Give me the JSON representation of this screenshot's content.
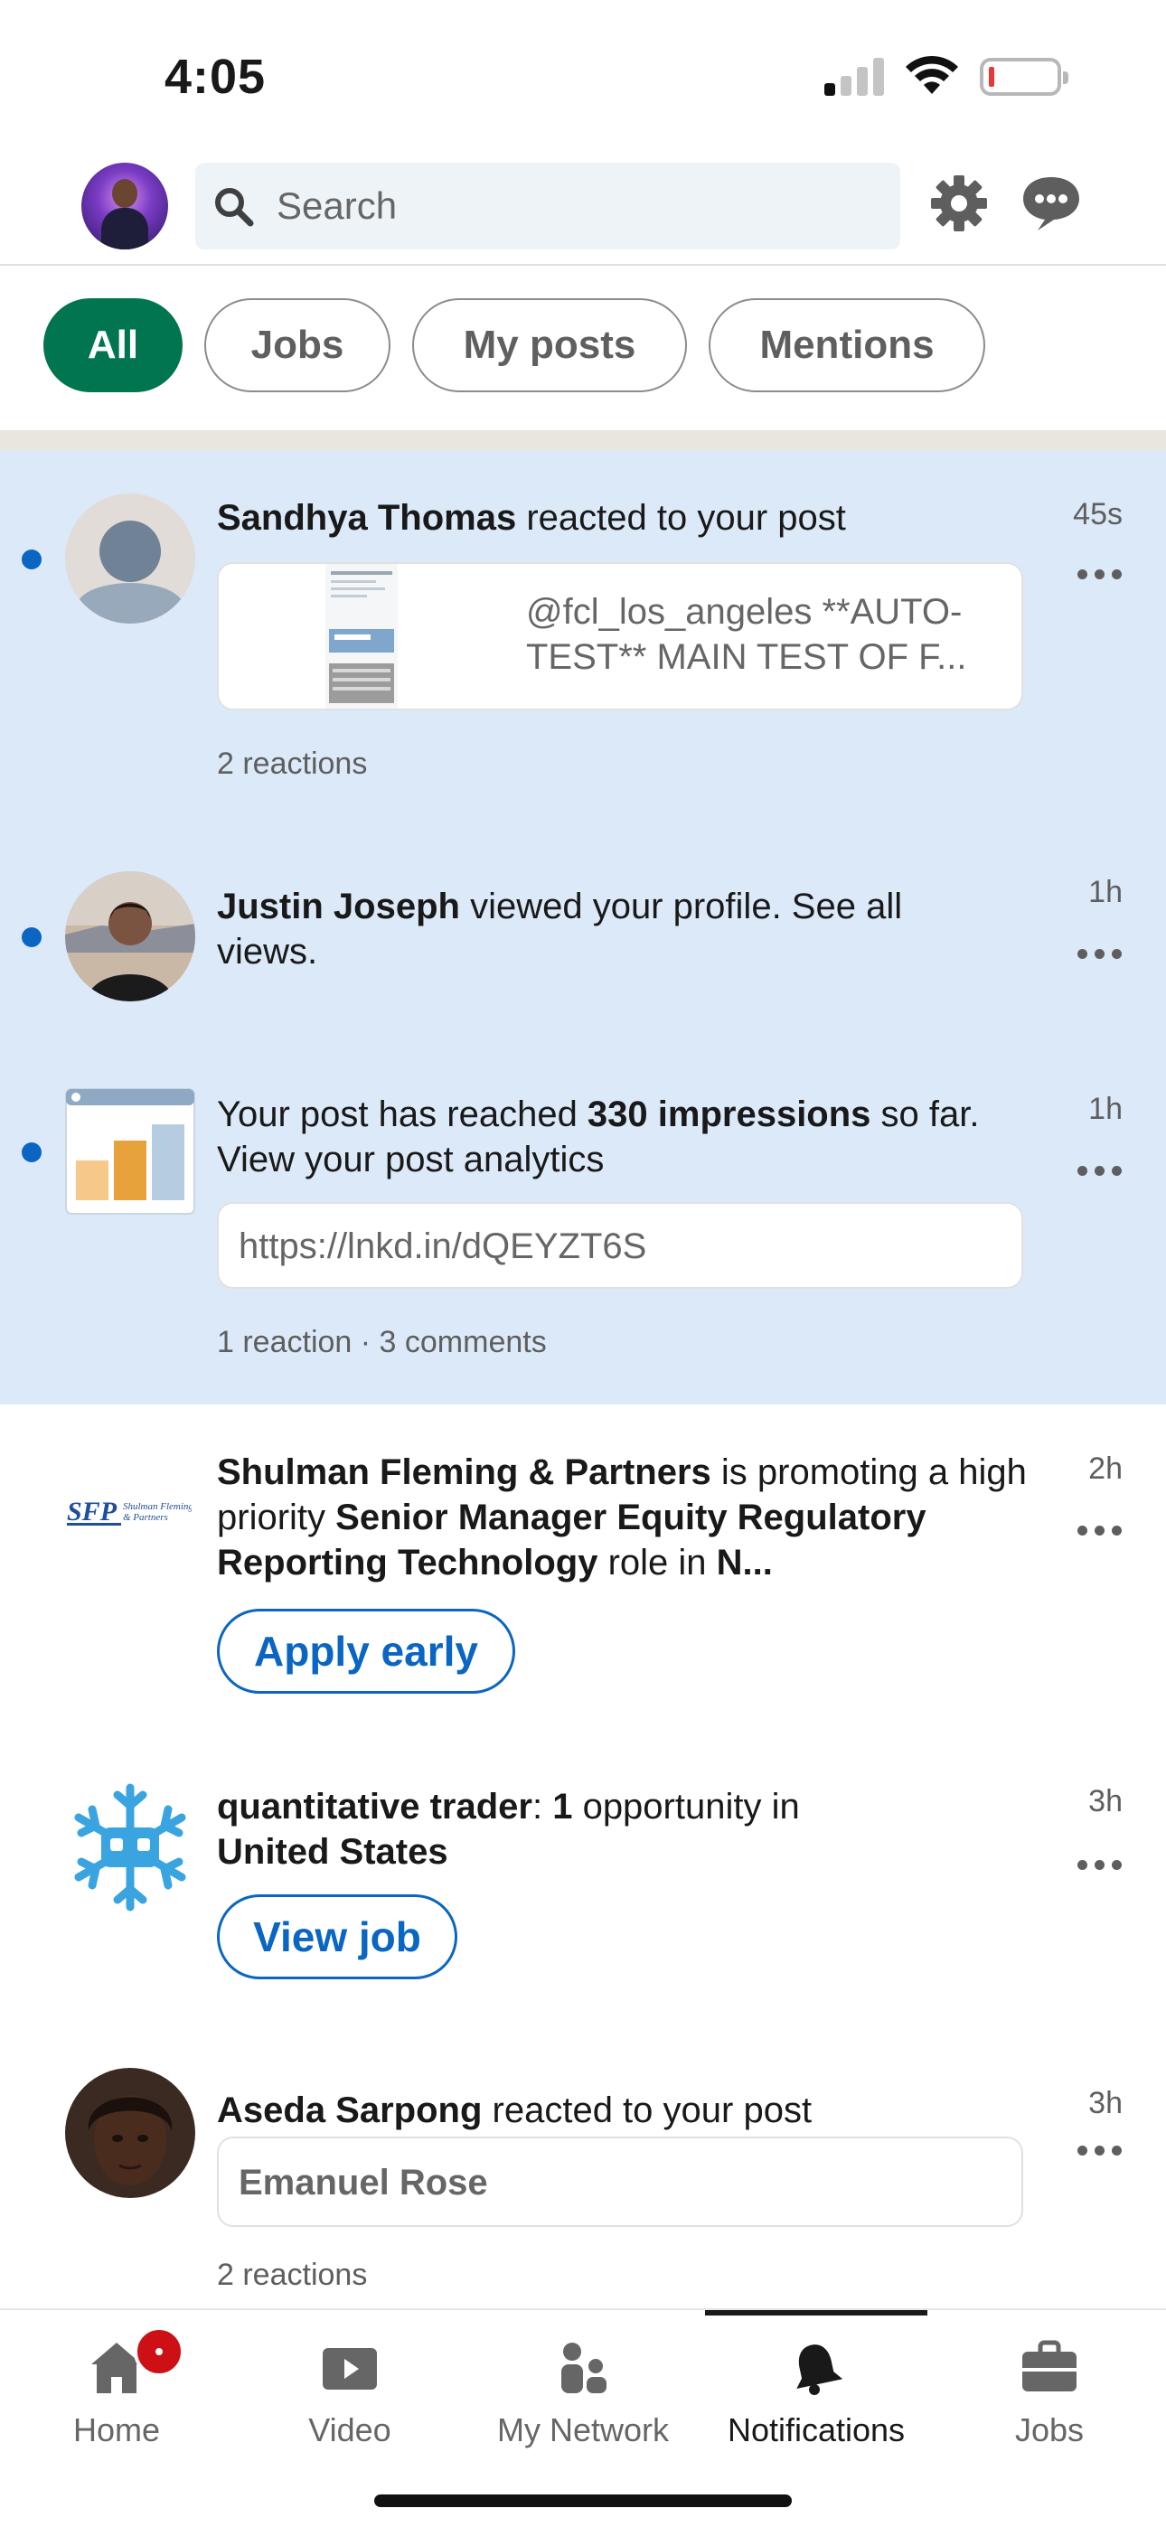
{
  "status_bar": {
    "time": "4:05"
  },
  "top_bar": {
    "search_placeholder": "Search"
  },
  "filters": [
    {
      "label": "All",
      "active": true
    },
    {
      "label": "Jobs",
      "active": false
    },
    {
      "label": "My posts",
      "active": false
    },
    {
      "label": "Mentions",
      "active": false
    }
  ],
  "notifications": [
    {
      "unread": true,
      "actor": "Sandhya Thomas",
      "action": " reacted to your post",
      "time": "45s",
      "card_text": "@fcl_los_angeles **AUTO-TEST** MAIN TEST OF F...",
      "meta": "2 reactions"
    },
    {
      "unread": true,
      "actor": "Justin Joseph",
      "action": " viewed your profile. See all views.",
      "time": "1h"
    },
    {
      "unread": true,
      "text_pre": "Your post has reached ",
      "text_bold": "330 impressions",
      "text_post": " so far. View your post analytics",
      "time": "1h",
      "card_text": "https://lnkd.in/dQEYZT6S",
      "meta": "1 reaction · 3 comments"
    },
    {
      "unread": false,
      "actor": "Shulman Fleming & Partners",
      "action_1": " is promoting a high priority ",
      "role": "Senior Manager Equity Regulatory Reporting Technology",
      "action_2": " role in ",
      "location_trunc": "N...",
      "time": "2h",
      "button": "Apply early"
    },
    {
      "unread": false,
      "query": "quantitative trader",
      "sep": ": ",
      "count": "1",
      "action": " opportunity in ",
      "location": "United States",
      "time": "3h",
      "button": "View job"
    },
    {
      "unread": false,
      "actor": "Aseda Sarpong",
      "action": " reacted to your post",
      "time": "3h",
      "card_text": "Emanuel Rose",
      "meta": "2 reactions"
    }
  ],
  "bottom_nav": [
    {
      "label": "Home",
      "icon": "home-icon",
      "badge": true
    },
    {
      "label": "Video",
      "icon": "video-icon"
    },
    {
      "label": "My Network",
      "icon": "my-network-icon"
    },
    {
      "label": "Notifications",
      "icon": "bell-icon",
      "active": true
    },
    {
      "label": "Jobs",
      "icon": "briefcase-icon"
    }
  ],
  "colors": {
    "accent_green": "#01754f",
    "linkedin_blue": "#0a66c2",
    "unread_bg": "#dce9f9",
    "badge_red": "#cc1016"
  }
}
